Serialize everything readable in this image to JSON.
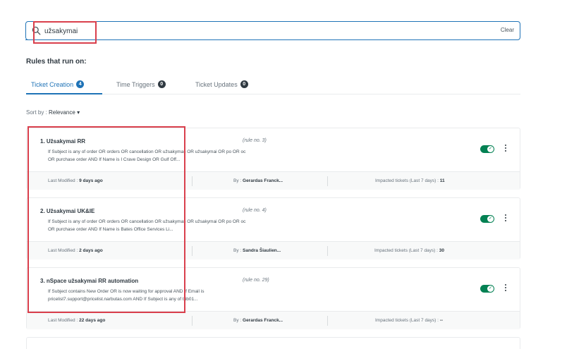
{
  "search": {
    "value": "užsakymai",
    "clear_label": "Clear"
  },
  "rules_heading": "Rules that run on:",
  "tabs": [
    {
      "label": "Ticket Creation",
      "count": "4",
      "active": true
    },
    {
      "label": "Time Triggers",
      "count": "0",
      "active": false
    },
    {
      "label": "Ticket Updates",
      "count": "0",
      "active": false
    }
  ],
  "sort": {
    "label": "Sort by :",
    "value": "Relevance"
  },
  "rules": [
    {
      "title": "1. Užsakymai RR",
      "rule_no": "(rule no. 3)",
      "desc_line1": "If Subject is any of order OR orders OR cancellation OR užsakymas OR užsakymai OR po OR oc",
      "desc_line2": "OR purchase order AND If Name is I Crave Design OR Gulf Off...",
      "last_modified_label": "Last Modified :",
      "last_modified": "9 days ago",
      "by_label": "By :",
      "by": "Gerardas Franck...",
      "impacted_label": "Impacted tickets (Last 7 days) :",
      "impacted": "11",
      "enabled": true
    },
    {
      "title": "2. Užsakymai UK&IE",
      "rule_no": "(rule no. 4)",
      "desc_line1": "If Subject is any of order OR orders OR cancellation OR užsakymas OR užsakymai OR po OR oc",
      "desc_line2": "OR purchase order AND If Name is Bates Office Services Li...",
      "last_modified_label": "Last Modified :",
      "last_modified": "2 days ago",
      "by_label": "By :",
      "by": "Sandra Šiaulien...",
      "impacted_label": "Impacted tickets (Last 7 days) :",
      "impacted": "30",
      "enabled": true
    },
    {
      "title": "3. nSpace užsakymai RR automation",
      "rule_no": "(rule no. 29)",
      "desc_line1": "If Subject contains New Order OR is now waiting for approval AND If Email is",
      "desc_line2": "pricelist7.support@pricelist.narbutas.com AND If Subject is any of trib01...",
      "last_modified_label": "Last Modified :",
      "last_modified": "22 days ago",
      "by_label": "By :",
      "by": "Gerardas Franck...",
      "impacted_label": "Impacted tickets (Last 7 days) :",
      "impacted": "--",
      "enabled": true
    }
  ],
  "colors": {
    "accent": "#1f73b7",
    "toggle_on": "#038153",
    "highlight": "#d93f4c"
  }
}
